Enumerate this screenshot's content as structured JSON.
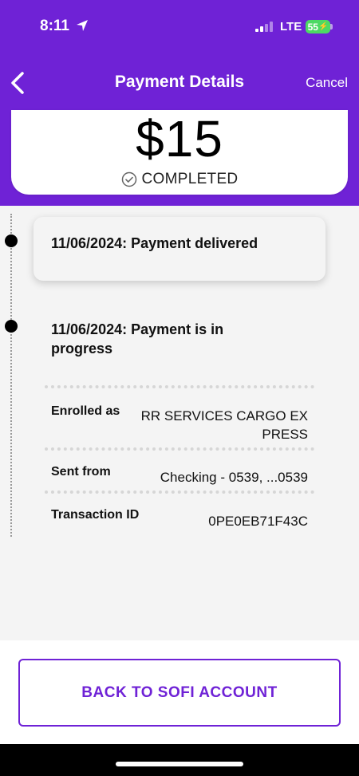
{
  "status_bar": {
    "time": "8:11",
    "network": "LTE",
    "battery": "55"
  },
  "nav": {
    "title": "Payment Details",
    "cancel_label": "Cancel"
  },
  "payment": {
    "amount": "$15",
    "status": "COMPLETED"
  },
  "timeline": [
    {
      "text": "11/06/2024: Payment delivered"
    },
    {
      "text": "11/06/2024: Payment is in progress"
    }
  ],
  "details": {
    "enrolled_label": "Enrolled as",
    "enrolled_value_line1": "RR SERVICES CARGO EX",
    "enrolled_value_line2": "PRESS",
    "sent_label": "Sent from",
    "sent_value": "Checking - 0539, ...0539",
    "txn_label": "Transaction ID",
    "txn_value": "0PE0EB71F43C"
  },
  "footer": {
    "button_label": "BACK TO SOFI ACCOUNT"
  },
  "colors": {
    "brand": "#6f22d6",
    "background": "#f4f4f4"
  }
}
